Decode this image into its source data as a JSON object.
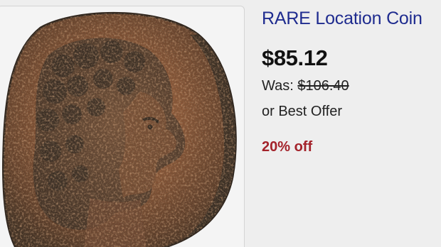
{
  "listing": {
    "title": "RARE Location Coin",
    "price": "$85.12",
    "was_label": "Was: ",
    "was_value": "$106.40",
    "offer_text": "or Best Offer",
    "discount": "20% off"
  },
  "colors": {
    "title_link": "#1f2c8f",
    "price": "#111111",
    "discount": "#a3222a",
    "background": "#eeeeee",
    "coin_copper": "#a25b33",
    "coin_dark": "#3c3024"
  }
}
